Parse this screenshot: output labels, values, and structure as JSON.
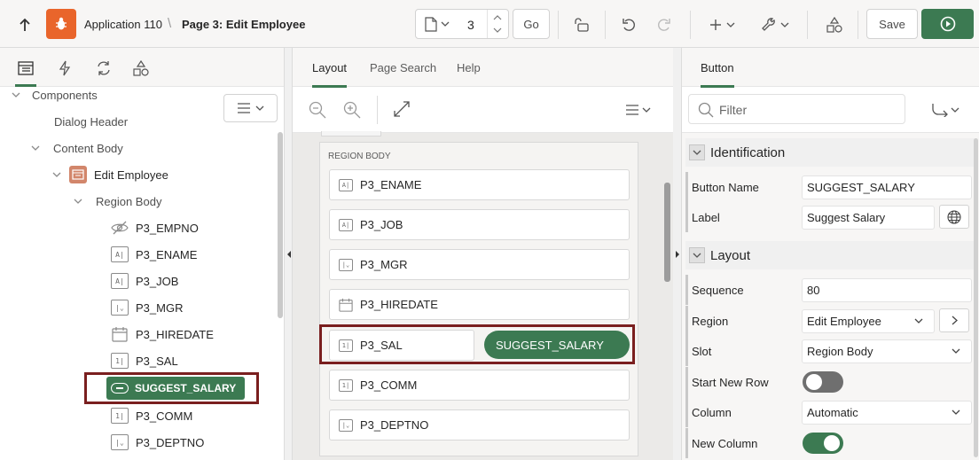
{
  "toolbar": {
    "app_name": "Application 110",
    "separator": "\\",
    "page_title": "Page 3: Edit Employee",
    "page_number": "3",
    "go_label": "Go",
    "save_label": "Save"
  },
  "left_panel": {
    "tree": [
      {
        "label": "Components",
        "level": 0,
        "chevron": true,
        "icon": ""
      },
      {
        "label": "Dialog Header",
        "level": 1,
        "chevron": false,
        "icon": ""
      },
      {
        "label": "Content Body",
        "level": 1,
        "chevron": true,
        "icon": ""
      },
      {
        "label": "Edit Employee",
        "level": 2,
        "chevron": true,
        "icon": "region-icon"
      },
      {
        "label": "Region Body",
        "level": 3,
        "chevron": true,
        "icon": ""
      },
      {
        "label": "P3_EMPNO",
        "level": 4,
        "chevron": false,
        "icon": "hidden-item-icon"
      },
      {
        "label": "P3_ENAME",
        "level": 4,
        "chevron": false,
        "icon": "text-field-icon"
      },
      {
        "label": "P3_JOB",
        "level": 4,
        "chevron": false,
        "icon": "text-field-icon"
      },
      {
        "label": "P3_MGR",
        "level": 4,
        "chevron": false,
        "icon": "select-list-icon"
      },
      {
        "label": "P3_HIREDATE",
        "level": 4,
        "chevron": false,
        "icon": "date-picker-icon"
      },
      {
        "label": "P3_SAL",
        "level": 4,
        "chevron": false,
        "icon": "number-field-icon"
      },
      {
        "label": "SUGGEST_SALARY",
        "level": 4,
        "chevron": false,
        "icon": "button-icon"
      },
      {
        "label": "P3_COMM",
        "level": 4,
        "chevron": false,
        "icon": "number-field-icon"
      },
      {
        "label": "P3_DEPTNO",
        "level": 4,
        "chevron": false,
        "icon": "select-list-icon"
      }
    ]
  },
  "middle_panel": {
    "tabs": [
      "Layout",
      "Page Search",
      "Help"
    ],
    "region_label": "REGION BODY",
    "items": [
      {
        "label": "P3_ENAME",
        "icon": "text-field-icon"
      },
      {
        "label": "P3_JOB",
        "icon": "text-field-icon"
      },
      {
        "label": "P3_MGR",
        "icon": "select-list-icon"
      },
      {
        "label": "P3_HIREDATE",
        "icon": "date-picker-icon"
      },
      {
        "label": "P3_SAL",
        "icon": "number-field-icon"
      },
      {
        "label": "P3_COMM",
        "icon": "number-field-icon"
      },
      {
        "label": "P3_DEPTNO",
        "icon": "select-list-icon"
      }
    ],
    "button_label": "SUGGEST_SALARY"
  },
  "right_panel": {
    "tab": "Button",
    "filter_placeholder": "Filter",
    "identification": {
      "title": "Identification",
      "button_name_label": "Button Name",
      "button_name_value": "SUGGEST_SALARY",
      "label_label": "Label",
      "label_value": "Suggest Salary"
    },
    "layout": {
      "title": "Layout",
      "sequence_label": "Sequence",
      "sequence_value": "80",
      "region_label": "Region",
      "region_value": "Edit Employee",
      "slot_label": "Slot",
      "slot_value": "Region Body",
      "start_new_row_label": "Start New Row",
      "start_new_row": false,
      "column_label": "Column",
      "column_value": "Automatic",
      "new_column_label": "New Column",
      "new_column": true
    }
  },
  "colors": {
    "accent_green": "#3c7a52",
    "highlight_border": "#7a1f1f",
    "app_icon": "#e9652b"
  }
}
